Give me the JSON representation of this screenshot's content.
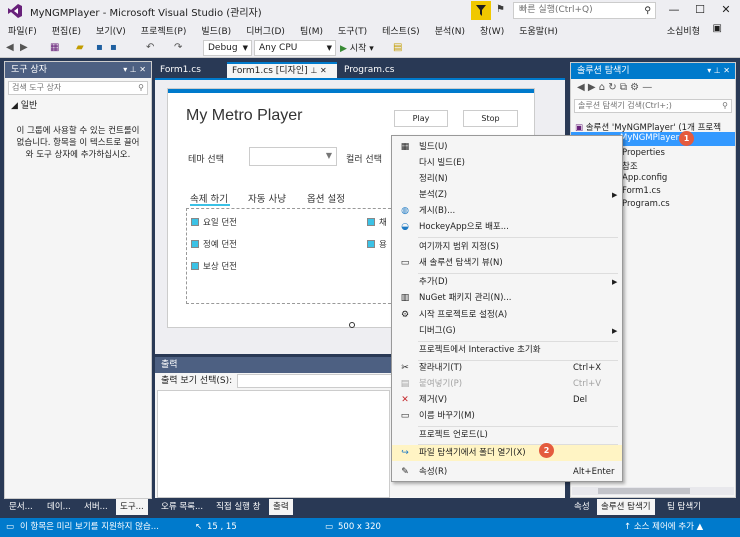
{
  "app": {
    "title": "MyNGMPlayer - Microsoft Visual Studio  (관리자)",
    "quick_launch_placeholder": "빠른 실행(Ctrl+Q)",
    "user": "소십비형"
  },
  "menu": [
    "파일(F)",
    "편집(E)",
    "보기(V)",
    "프로젝트(P)",
    "빌드(B)",
    "디버그(D)",
    "팀(M)",
    "도구(T)",
    "테스트(S)",
    "분석(N)",
    "창(W)",
    "도움말(H)"
  ],
  "toolbar": {
    "config": "Debug",
    "platform": "Any CPU",
    "start_label": "시작"
  },
  "toolbox": {
    "title": "도구 상자",
    "search_placeholder": "검색 도구 상자",
    "group": "◢ 일반",
    "message": "이 그룹에 사용할 수 있는 컨트롤이 없습니다. 항목을 이 텍스트로 끌어와 도구 상자에 추가하십시오."
  },
  "doc_tabs": [
    "Form1.cs",
    "Form1.cs [디자인]",
    "Program.cs"
  ],
  "form": {
    "title": "My Metro Player",
    "play": "Play",
    "stop": "Stop",
    "theme_label": "테마 선택",
    "color_label": "컬러 선택",
    "tabs": [
      "속제 하기",
      "자동 사냥",
      "옵션 설정"
    ],
    "checks_left": [
      "요일 던전",
      "정예 던전",
      "보상 던전"
    ],
    "checks_right": [
      "채",
      "용"
    ]
  },
  "output": {
    "title": "출력",
    "source_label": "출력 보기 선택(S):"
  },
  "solution": {
    "title": "솔루션 탐색기",
    "search_placeholder": "솔루션 탐색기 검색(Ctrl+;)",
    "root": "솔루션 'MyNGMPlayer' (1개 프로젝",
    "project": "MyNGMPlayer",
    "items": [
      "Properties",
      "참조",
      "App.config",
      "Form1.cs",
      "Program.cs"
    ]
  },
  "context_menu": {
    "items": [
      {
        "label": "빌드(U)",
        "shortcut": ""
      },
      {
        "label": "다시 빌드(E)",
        "shortcut": ""
      },
      {
        "label": "정리(N)",
        "shortcut": ""
      },
      {
        "label": "분석(Z)",
        "shortcut": ""
      },
      {
        "label": "게시(B)...",
        "shortcut": ""
      },
      {
        "label": "HockeyApp으로 배포...",
        "shortcut": ""
      },
      {
        "label": "여기까지 범위 지정(S)",
        "shortcut": ""
      },
      {
        "label": "새 솔루션 탐색기 뷰(N)",
        "shortcut": ""
      },
      {
        "label": "추가(D)",
        "shortcut": ""
      },
      {
        "label": "NuGet 패키지 관리(N)...",
        "shortcut": ""
      },
      {
        "label": "시작 프로젝트로 설정(A)",
        "shortcut": ""
      },
      {
        "label": "디버그(G)",
        "shortcut": ""
      },
      {
        "label": "프로젝트에서 Interactive 초기화",
        "shortcut": ""
      },
      {
        "label": "잘라내기(T)",
        "shortcut": "Ctrl+X"
      },
      {
        "label": "붙여넣기(P)",
        "shortcut": "Ctrl+V"
      },
      {
        "label": "제거(V)",
        "shortcut": "Del"
      },
      {
        "label": "이름 바꾸기(M)",
        "shortcut": ""
      },
      {
        "label": "프로젝트 언로드(L)",
        "shortcut": ""
      },
      {
        "label": "파일 탐색기에서 폴더 열기(X)",
        "shortcut": ""
      },
      {
        "label": "속성(R)",
        "shortcut": "Alt+Enter"
      }
    ]
  },
  "badges": [
    "1",
    "2"
  ],
  "bottom_tabs_left": [
    "문서...",
    "데이...",
    "서버...",
    "도구..."
  ],
  "bottom_tabs_mid": [
    "오류 목록...",
    "직접 실행 창",
    "출력"
  ],
  "bottom_tabs_right": [
    "속성",
    "솔루션 탐색기",
    "팀 탐색기"
  ],
  "status": {
    "message": "이 항목은 미리 보기를 지원하지 않습...",
    "position": "15 , 15",
    "size": "500 x 320",
    "source_control": "↑ 소스 제어에 추가 ▲"
  }
}
